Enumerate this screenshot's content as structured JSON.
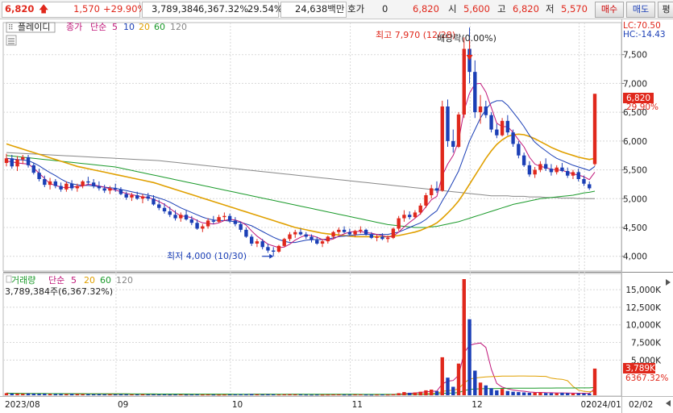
{
  "header": {
    "price": "6,820",
    "change": "1,570",
    "change_pct": "+29.90%",
    "volume": "3,789,384",
    "volume_ratio": "6,367.32%",
    "turnover": "29.54%",
    "amount": "24,638백만",
    "quote_label": "호가",
    "quote_value": "0",
    "quote_price": "6,820",
    "open_label": "시",
    "open_value": "5,600",
    "high_label": "고",
    "high_value": "6,820",
    "low_label": "저",
    "low_value": "5,570",
    "buy_button": "매수",
    "sell_button": "매도",
    "eval_button": "평"
  },
  "price_panel": {
    "mode_button": "플레이디",
    "indicator_name": "종가",
    "indicator_type": "단순",
    "ma_periods": [
      "5",
      "10",
      "20",
      "60",
      "120"
    ],
    "lc_label": "LC:70.50",
    "hc_label": "HC:-14.43",
    "high_annot": "최고 7,970 (12/28)",
    "low_annot": "최저 4,000 (10/30)",
    "event_annot": "배당락(0.00%)",
    "price_badge": "6,820",
    "pct_badge": "29.90%",
    "y_ticks": [
      "7,500",
      "7,000",
      "6,500",
      "6,000",
      "5,500",
      "5,000",
      "4,500",
      "4,000"
    ]
  },
  "volume_panel": {
    "title": "거래량",
    "indicator_type": "단순",
    "ma_periods": [
      "5",
      "20",
      "60",
      "120"
    ],
    "volume_text": "3,789,384주(6,367.32%)",
    "vol_badge": "3,789K",
    "vol_pct_badge": "6367.32%",
    "y_ticks": [
      "15,000K",
      "12,500K",
      "10,000K",
      "7,500K",
      "5,000K"
    ]
  },
  "x_axis": {
    "labels": [
      "2023/08",
      "09",
      "10",
      "11",
      "12",
      "2024/01",
      "02",
      "02/02"
    ]
  },
  "colors": {
    "up": "#e0281c",
    "down": "#1b3fb6",
    "ma5": "#c0177a",
    "ma10": "#1b3fb6",
    "ma20": "#e0a000",
    "ma60": "#1a9a2a",
    "ma120": "#888888"
  },
  "chart_data": {
    "type": "candlestick",
    "price_ylim": [
      3800,
      8000
    ],
    "volume_ylim": [
      0,
      16500000
    ],
    "candles": [
      [
        5620,
        5780,
        5560,
        5700
      ],
      [
        5700,
        5760,
        5520,
        5560
      ],
      [
        5560,
        5740,
        5480,
        5680
      ],
      [
        5680,
        5760,
        5600,
        5720
      ],
      [
        5720,
        5760,
        5540,
        5580
      ],
      [
        5580,
        5620,
        5420,
        5450
      ],
      [
        5450,
        5520,
        5300,
        5340
      ],
      [
        5340,
        5400,
        5200,
        5240
      ],
      [
        5240,
        5360,
        5160,
        5300
      ],
      [
        5300,
        5340,
        5180,
        5220
      ],
      [
        5220,
        5280,
        5120,
        5160
      ],
      [
        5160,
        5300,
        5120,
        5260
      ],
      [
        5260,
        5320,
        5140,
        5180
      ],
      [
        5180,
        5260,
        5120,
        5220
      ],
      [
        5220,
        5320,
        5180,
        5300
      ],
      [
        5300,
        5380,
        5240,
        5280
      ],
      [
        5280,
        5340,
        5180,
        5220
      ],
      [
        5220,
        5300,
        5140,
        5180
      ],
      [
        5180,
        5240,
        5100,
        5140
      ],
      [
        5140,
        5220,
        5080,
        5180
      ],
      [
        5180,
        5260,
        5120,
        5160
      ],
      [
        5160,
        5200,
        5060,
        5080
      ],
      [
        5080,
        5120,
        4980,
        5020
      ],
      [
        5020,
        5100,
        4960,
        5060
      ],
      [
        5060,
        5120,
        4980,
        5000
      ],
      [
        5000,
        5080,
        4920,
        5040
      ],
      [
        5040,
        5100,
        4960,
        5000
      ],
      [
        5000,
        5060,
        4880,
        4900
      ],
      [
        4900,
        4980,
        4800,
        4840
      ],
      [
        4840,
        4920,
        4740,
        4780
      ],
      [
        4780,
        4860,
        4680,
        4720
      ],
      [
        4720,
        4800,
        4620,
        4660
      ],
      [
        4660,
        4760,
        4600,
        4720
      ],
      [
        4720,
        4800,
        4620,
        4640
      ],
      [
        4640,
        4700,
        4540,
        4580
      ],
      [
        4580,
        4640,
        4460,
        4480
      ],
      [
        4480,
        4560,
        4420,
        4520
      ],
      [
        4520,
        4660,
        4480,
        4620
      ],
      [
        4620,
        4700,
        4560,
        4600
      ],
      [
        4600,
        4720,
        4580,
        4680
      ],
      [
        4680,
        4760,
        4620,
        4700
      ],
      [
        4700,
        4740,
        4580,
        4620
      ],
      [
        4620,
        4680,
        4520,
        4560
      ],
      [
        4560,
        4600,
        4420,
        4460
      ],
      [
        4460,
        4500,
        4320,
        4340
      ],
      [
        4340,
        4380,
        4180,
        4220
      ],
      [
        4220,
        4300,
        4160,
        4260
      ],
      [
        4260,
        4300,
        4120,
        4160
      ],
      [
        4160,
        4220,
        4060,
        4100
      ],
      [
        4100,
        4160,
        4000,
        4080
      ],
      [
        4080,
        4200,
        4060,
        4180
      ],
      [
        4180,
        4320,
        4160,
        4300
      ],
      [
        4300,
        4420,
        4260,
        4380
      ],
      [
        4380,
        4460,
        4320,
        4420
      ],
      [
        4420,
        4480,
        4360,
        4380
      ],
      [
        4380,
        4420,
        4300,
        4340
      ],
      [
        4340,
        4380,
        4240,
        4280
      ],
      [
        4280,
        4340,
        4200,
        4220
      ],
      [
        4220,
        4300,
        4160,
        4260
      ],
      [
        4260,
        4360,
        4220,
        4340
      ],
      [
        4340,
        4440,
        4300,
        4420
      ],
      [
        4420,
        4500,
        4380,
        4460
      ],
      [
        4460,
        4520,
        4400,
        4420
      ],
      [
        4420,
        4480,
        4360,
        4380
      ],
      [
        4380,
        4460,
        4340,
        4440
      ],
      [
        4440,
        4520,
        4400,
        4460
      ],
      [
        4460,
        4480,
        4360,
        4380
      ],
      [
        4380,
        4420,
        4300,
        4320
      ],
      [
        4320,
        4380,
        4260,
        4340
      ],
      [
        4340,
        4400,
        4280,
        4300
      ],
      [
        4300,
        4360,
        4240,
        4320
      ],
      [
        4320,
        4500,
        4300,
        4480
      ],
      [
        4480,
        4700,
        4440,
        4660
      ],
      [
        4660,
        4800,
        4600,
        4720
      ],
      [
        4720,
        4780,
        4640,
        4680
      ],
      [
        4680,
        4800,
        4660,
        4760
      ],
      [
        4760,
        4920,
        4720,
        4880
      ],
      [
        4880,
        5100,
        4840,
        5060
      ],
      [
        5060,
        5240,
        5000,
        5180
      ],
      [
        5180,
        5300,
        5100,
        5140
      ],
      [
        5140,
        6700,
        5120,
        6600
      ],
      [
        6600,
        6720,
        5900,
        6000
      ],
      [
        6000,
        6200,
        5800,
        5900
      ],
      [
        5900,
        6500,
        5880,
        6460
      ],
      [
        6460,
        7800,
        6400,
        7600
      ],
      [
        7600,
        7970,
        7000,
        7200
      ],
      [
        7200,
        7400,
        6400,
        6500
      ],
      [
        6500,
        6800,
        6300,
        6600
      ],
      [
        6600,
        6700,
        6400,
        6450
      ],
      [
        6450,
        6500,
        6150,
        6200
      ],
      [
        6200,
        6300,
        6050,
        6100
      ],
      [
        6100,
        6400,
        6080,
        6350
      ],
      [
        6350,
        6450,
        6100,
        6150
      ],
      [
        6150,
        6200,
        5900,
        5950
      ],
      [
        5950,
        6000,
        5700,
        5750
      ],
      [
        5750,
        5800,
        5550,
        5580
      ],
      [
        5580,
        5650,
        5380,
        5420
      ],
      [
        5420,
        5550,
        5360,
        5500
      ],
      [
        5500,
        5650,
        5460,
        5600
      ],
      [
        5600,
        5700,
        5480,
        5520
      ],
      [
        5520,
        5600,
        5400,
        5460
      ],
      [
        5460,
        5580,
        5420,
        5540
      ],
      [
        5540,
        5620,
        5460,
        5480
      ],
      [
        5480,
        5540,
        5360,
        5400
      ],
      [
        5400,
        5500,
        5340,
        5460
      ],
      [
        5460,
        5520,
        5300,
        5340
      ],
      [
        5340,
        5400,
        5220,
        5260
      ],
      [
        5250,
        5300,
        5150,
        5180
      ],
      [
        5600,
        6820,
        5570,
        6820
      ]
    ],
    "volumes": [
      300000,
      250000,
      220000,
      200000,
      260000,
      240000,
      210000,
      230000,
      200000,
      180000,
      190000,
      170000,
      200000,
      180000,
      160000,
      170000,
      150000,
      160000,
      140000,
      150000,
      130000,
      150000,
      140000,
      120000,
      130000,
      140000,
      120000,
      130000,
      110000,
      120000,
      100000,
      110000,
      120000,
      100000,
      110000,
      120000,
      100000,
      110000,
      100000,
      90000,
      100000,
      110000,
      120000,
      130000,
      140000,
      160000,
      120000,
      110000,
      130000,
      120000,
      110000,
      130000,
      140000,
      120000,
      110000,
      100000,
      90000,
      100000,
      90000,
      100000,
      110000,
      120000,
      100000,
      90000,
      110000,
      120000,
      100000,
      90000,
      100000,
      110000,
      100000,
      150000,
      300000,
      450000,
      350000,
      400000,
      500000,
      700000,
      800000,
      600000,
      5400000,
      2500000,
      1200000,
      4500000,
      16500000,
      10800000,
      3500000,
      1800000,
      1400000,
      1000000,
      700000,
      900000,
      600000,
      500000,
      450000,
      400000,
      350000,
      380000,
      400000,
      320000,
      300000,
      280000,
      350000,
      300000,
      250000,
      280000,
      260000,
      230000,
      3789384
    ],
    "ma5": [
      5650,
      5640,
      5620,
      5610,
      5600,
      5530,
      5440,
      5350,
      5260,
      5230,
      5200,
      5190,
      5200,
      5210,
      5220,
      5250,
      5240,
      5220,
      5200,
      5170,
      5150,
      5120,
      5090,
      5070,
      5050,
      5030,
      5020,
      4990,
      4950,
      4900,
      4830,
      4760,
      4700,
      4690,
      4670,
      4620,
      4580,
      4570,
      4560,
      4580,
      4620,
      4640,
      4630,
      4600,
      4540,
      4440,
      4350,
      4280,
      4210,
      4180,
      4150,
      4160,
      4210,
      4280,
      4330,
      4370,
      4360,
      4330,
      4290,
      4280,
      4300,
      4350,
      4390,
      4420,
      4430,
      4430,
      4410,
      4400,
      4380,
      4360,
      4330,
      4350,
      4420,
      4510,
      4590,
      4660,
      4740,
      4860,
      4980,
      5040,
      5400,
      5600,
      5750,
      6000,
      6530,
      6830,
      6990,
      7000,
      6850,
      6580,
      6310,
      6250,
      6250,
      6150,
      6020,
      5900,
      5720,
      5600,
      5560,
      5540,
      5510,
      5500,
      5490,
      5460,
      5430,
      5410,
      5380,
      5330,
      5460
    ],
    "ma10": [
      5700,
      5690,
      5680,
      5670,
      5660,
      5620,
      5570,
      5510,
      5450,
      5400,
      5340,
      5290,
      5260,
      5240,
      5230,
      5230,
      5220,
      5210,
      5200,
      5190,
      5180,
      5160,
      5140,
      5120,
      5100,
      5080,
      5060,
      5040,
      5010,
      4980,
      4940,
      4890,
      4840,
      4800,
      4760,
      4720,
      4680,
      4650,
      4630,
      4620,
      4620,
      4610,
      4600,
      4590,
      4560,
      4530,
      4480,
      4430,
      4380,
      4330,
      4290,
      4260,
      4240,
      4240,
      4260,
      4280,
      4290,
      4290,
      4290,
      4300,
      4320,
      4340,
      4350,
      4360,
      4370,
      4380,
      4380,
      4380,
      4380,
      4380,
      4380,
      4400,
      4420,
      4460,
      4500,
      4540,
      4580,
      4640,
      4720,
      4790,
      4960,
      5120,
      5300,
      5480,
      5740,
      6000,
      6200,
      6400,
      6550,
      6660,
      6700,
      6700,
      6620,
      6500,
      6380,
      6250,
      6100,
      5980,
      5900,
      5830,
      5760,
      5700,
      5660,
      5620,
      5580,
      5550,
      5520,
      5490,
      5560
    ],
    "ma20": [
      5950,
      5920,
      5890,
      5860,
      5830,
      5800,
      5770,
      5740,
      5710,
      5680,
      5650,
      5620,
      5590,
      5560,
      5540,
      5520,
      5500,
      5480,
      5460,
      5440,
      5420,
      5400,
      5380,
      5360,
      5340,
      5320,
      5300,
      5280,
      5250,
      5220,
      5190,
      5160,
      5130,
      5100,
      5070,
      5040,
      5010,
      4980,
      4950,
      4920,
      4890,
      4860,
      4830,
      4800,
      4770,
      4740,
      4710,
      4680,
      4650,
      4620,
      4590,
      4560,
      4530,
      4500,
      4480,
      4460,
      4440,
      4420,
      4400,
      4390,
      4380,
      4370,
      4360,
      4350,
      4340,
      4340,
      4340,
      4340,
      4340,
      4340,
      4340,
      4350,
      4360,
      4380,
      4400,
      4420,
      4450,
      4490,
      4530,
      4580,
      4660,
      4750,
      4850,
      4960,
      5100,
      5250,
      5400,
      5550,
      5700,
      5830,
      5940,
      6020,
      6080,
      6110,
      6120,
      6110,
      6080,
      6040,
      5990,
      5940,
      5890,
      5850,
      5810,
      5780,
      5750,
      5720,
      5700,
      5680,
      5700
    ],
    "ma60": [
      5750,
      5740,
      5730,
      5720,
      5710,
      5700,
      5690,
      5680,
      5670,
      5660,
      5650,
      5640,
      5630,
      5620,
      5610,
      5600,
      5590,
      5580,
      5570,
      5560,
      5550,
      5530,
      5510,
      5490,
      5470,
      5450,
      5430,
      5410,
      5390,
      5370,
      5350,
      5330,
      5310,
      5290,
      5270,
      5250,
      5230,
      5210,
      5190,
      5170,
      5150,
      5130,
      5110,
      5090,
      5070,
      5050,
      5030,
      5010,
      4990,
      4970,
      4950,
      4930,
      4910,
      4890,
      4870,
      4850,
      4830,
      4810,
      4790,
      4770,
      4750,
      4730,
      4710,
      4690,
      4670,
      4650,
      4630,
      4610,
      4590,
      4570,
      4550,
      4540,
      4530,
      4520,
      4510,
      4500,
      4500,
      4500,
      4510,
      4520,
      4540,
      4560,
      4580,
      4600,
      4630,
      4660,
      4690,
      4720,
      4750,
      4780,
      4810,
      4840,
      4870,
      4900,
      4920,
      4940,
      4960,
      4980,
      5000,
      5010,
      5020,
      5030,
      5040,
      5050,
      5060,
      5080,
      5100,
      5110,
      5130
    ],
    "ma120": [
      5800,
      5795,
      5790,
      5785,
      5780,
      5775,
      5770,
      5765,
      5760,
      5755,
      5750,
      5745,
      5740,
      5735,
      5730,
      5725,
      5720,
      5715,
      5710,
      5705,
      5700,
      5695,
      5690,
      5685,
      5680,
      5675,
      5670,
      5665,
      5660,
      5650,
      5640,
      5630,
      5620,
      5610,
      5600,
      5590,
      5580,
      5570,
      5560,
      5550,
      5540,
      5530,
      5520,
      5510,
      5500,
      5490,
      5480,
      5470,
      5460,
      5450,
      5440,
      5430,
      5420,
      5410,
      5400,
      5390,
      5380,
      5370,
      5360,
      5350,
      5340,
      5330,
      5320,
      5310,
      5300,
      5290,
      5280,
      5270,
      5260,
      5250,
      5240,
      5230,
      5220,
      5210,
      5200,
      5190,
      5180,
      5170,
      5160,
      5150,
      5140,
      5130,
      5120,
      5110,
      5100,
      5090,
      5080,
      5070,
      5060,
      5050,
      5050,
      5050,
      5050,
      5040,
      5040,
      5040,
      5030,
      5030,
      5030,
      5020,
      5020,
      5020,
      5010,
      5010,
      5010,
      5000,
      5000,
      5000,
      5000
    ]
  }
}
